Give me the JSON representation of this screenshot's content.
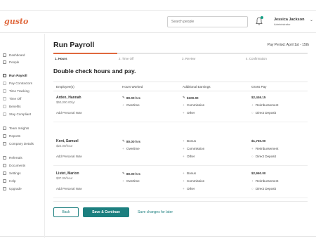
{
  "app": {
    "logo": "gusto"
  },
  "header": {
    "search_placeholder": "Search people",
    "user_name": "Jessica Jackson",
    "user_role": "Administrator"
  },
  "sidebar": {
    "items": [
      {
        "label": "Dashboard",
        "active": false,
        "sub": false
      },
      {
        "label": "People",
        "active": false,
        "sub": false
      },
      {
        "label": "Run Payroll",
        "active": true,
        "sub": false
      },
      {
        "label": "Pay Contractors",
        "active": false,
        "sub": true
      },
      {
        "label": "Time Tracking",
        "active": false,
        "sub": true
      },
      {
        "label": "Time Off",
        "active": false,
        "sub": true
      },
      {
        "label": "Benefits",
        "active": false,
        "sub": true
      },
      {
        "label": "Stay Compliant",
        "active": false,
        "sub": true
      },
      {
        "label": "Team Insights",
        "active": false,
        "sub": false
      },
      {
        "label": "Reports",
        "active": false,
        "sub": false
      },
      {
        "label": "Company Details",
        "active": false,
        "sub": false
      },
      {
        "label": "Referrals",
        "active": false,
        "sub": false
      },
      {
        "label": "Documents",
        "active": false,
        "sub": false
      },
      {
        "label": "Settings",
        "active": false,
        "sub": false
      },
      {
        "label": "Help",
        "active": false,
        "sub": false
      },
      {
        "label": "Upgrade",
        "active": false,
        "sub": false
      }
    ]
  },
  "page": {
    "title": "Run Payroll",
    "pay_period": "Pay Period: April 1st - 15th",
    "progress": 0.25,
    "steps": [
      "1. Hours",
      "2. Time Off",
      "3. Review",
      "4. Confirmation"
    ],
    "section_title": "Double check hours and pay."
  },
  "table": {
    "headers": [
      "Employee(s)",
      "Hours Worked",
      "Additional Earnings",
      "Gross Pay"
    ],
    "rows": [
      {
        "name": "Arden, Hannah",
        "rate": "$50,000.00/yr",
        "note": "Add Personal Note",
        "hours": "80.00 hrs",
        "overtime": "Overtime",
        "earnings": [
          "$100.00",
          "Commission",
          "Other"
        ],
        "gross": "$2,446.15",
        "reimbursement": "Reimbursement",
        "deposit": "Direct Deposit"
      },
      {
        "name": "Kent, Samuel",
        "rate": "$22.00/hour",
        "note": "Add Personal Note",
        "hours": "80.00 hrs",
        "overtime": "Overtime",
        "earnings": [
          "Bonus",
          "Commission",
          "Other"
        ],
        "gross": "$1,760.00",
        "reimbursement": "Reimbursement",
        "deposit": "Direct Deposit"
      },
      {
        "name": "Listet, Marion",
        "rate": "$37.00/hour",
        "note": "Add Personal Note",
        "hours": "80.00 hrs",
        "overtime": "Overtime",
        "earnings": [
          "Bonus",
          "Commission",
          "Other"
        ],
        "gross": "$2,960.00",
        "reimbursement": "Reimbursement",
        "deposit": "Direct Deposit"
      }
    ]
  },
  "footer": {
    "back_label": "Back",
    "save_continue_label": "Save & Continue",
    "save_later_label": "Save changes for later"
  },
  "colors": {
    "brand": "#e0693e",
    "accent": "#1c7f7f",
    "badge": "#16a085"
  }
}
